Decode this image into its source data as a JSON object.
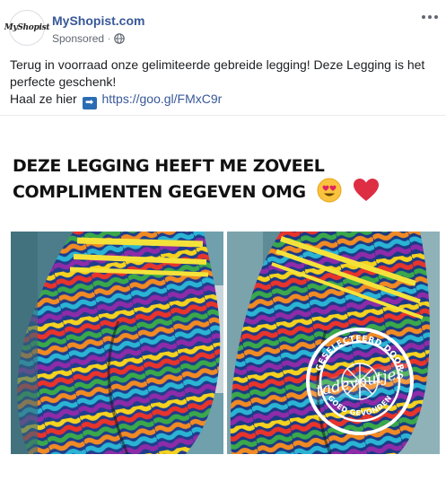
{
  "post": {
    "avatar_text": "MyShopist",
    "page_name": "MyShopist.com",
    "sponsored": "Sponsored",
    "separator": "·",
    "privacy_icon": "globe-icon",
    "more_icon": "more-options-icon",
    "text_line1": "Terug in voorraad onze gelimiteerde gebreide legging! Deze Legging is het perfecte geschenk!",
    "text_prefix": "Haal ze hier",
    "arrow_icon": "➡",
    "link": "https://goo.gl/FMxC9r"
  },
  "creative": {
    "headline_line1": "DEZE LEGGING HEEFT ME ZOVEEL",
    "headline_line2": "COMPLIMENTEN GEGEVEN OMG",
    "emojis": [
      "heart-eyes-emoji",
      "red-heart-emoji"
    ],
    "badge_top": "GESELECTEERD DOOR",
    "badge_brand": "tadevoutjes",
    "badge_bottom": "GOED GEVONDEN",
    "colors": {
      "link": "#385898",
      "badge": "#ffffff"
    }
  }
}
